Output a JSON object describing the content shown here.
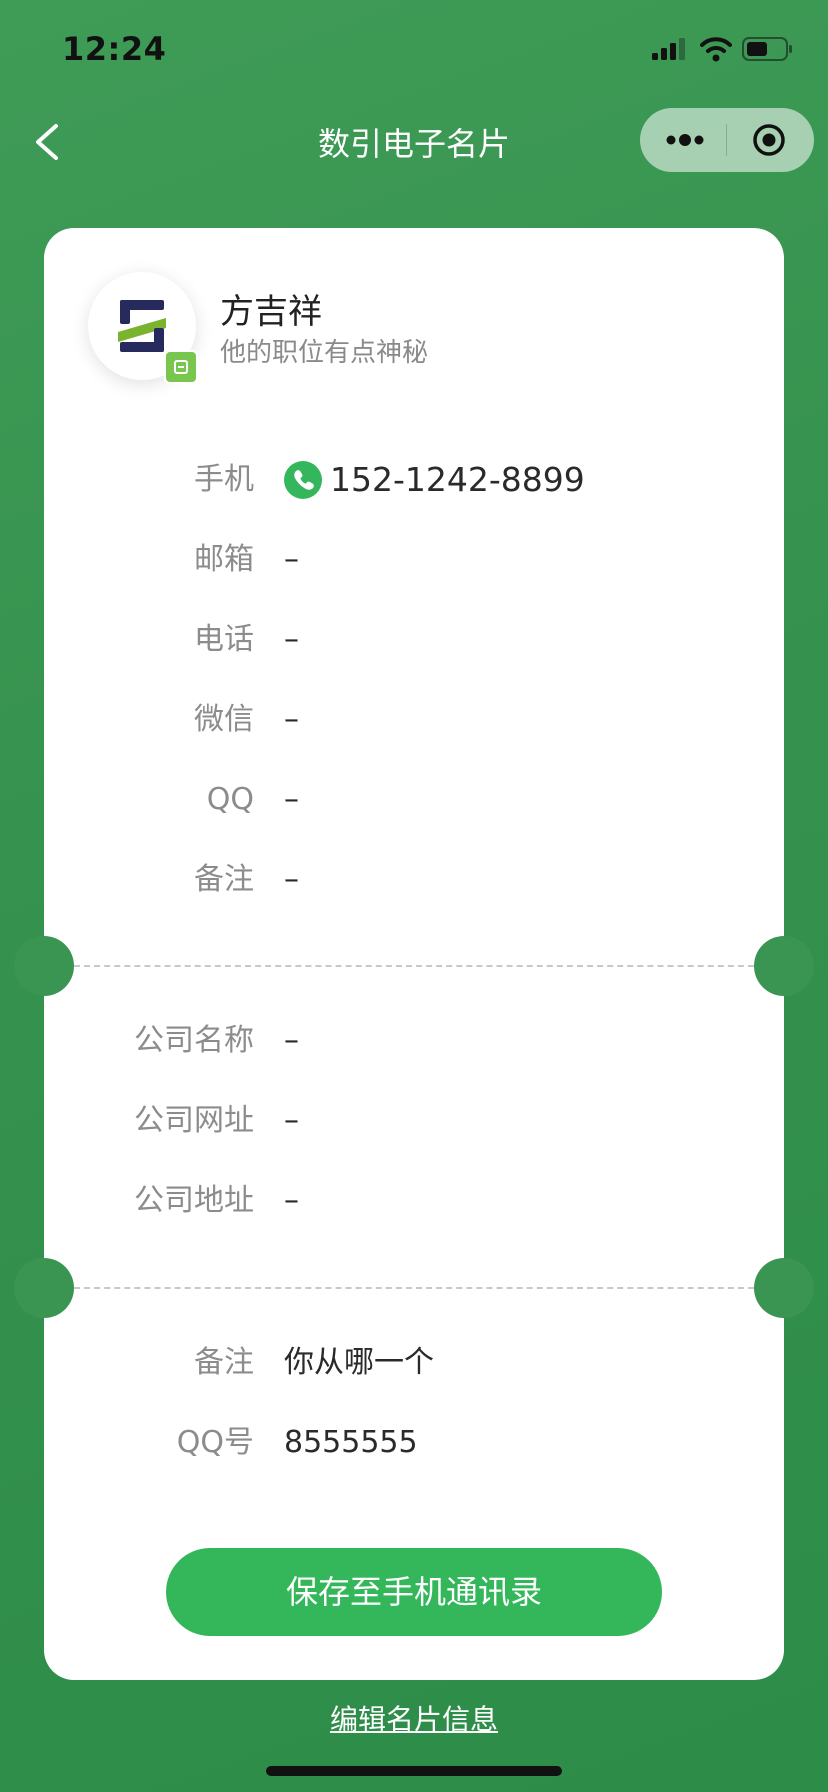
{
  "status_bar": {
    "time": "12:24"
  },
  "nav": {
    "title": "数引电子名片"
  },
  "profile": {
    "name": "方吉祥",
    "job": "他的职位有点神秘"
  },
  "contact_rows": [
    {
      "label": "手机",
      "value": "152-1242-8899"
    },
    {
      "label": "邮箱",
      "value": "–"
    },
    {
      "label": "电话",
      "value": "–"
    },
    {
      "label": "微信",
      "value": "–"
    },
    {
      "label": "QQ",
      "value": "–"
    },
    {
      "label": "备注",
      "value": "–"
    }
  ],
  "company_rows": [
    {
      "label": "公司名称",
      "value": "–"
    },
    {
      "label": "公司网址",
      "value": "–"
    },
    {
      "label": "公司地址",
      "value": "–"
    }
  ],
  "extra_rows": [
    {
      "label": "备注",
      "value": "你从哪一个"
    },
    {
      "label": "QQ号",
      "value": "8555555"
    }
  ],
  "actions": {
    "save_label": "保存至手机通讯录",
    "edit_label": "编辑名片信息"
  },
  "colors": {
    "background": "#3a9552",
    "primary_button": "#33b75a",
    "phone_icon": "#34b75c"
  }
}
